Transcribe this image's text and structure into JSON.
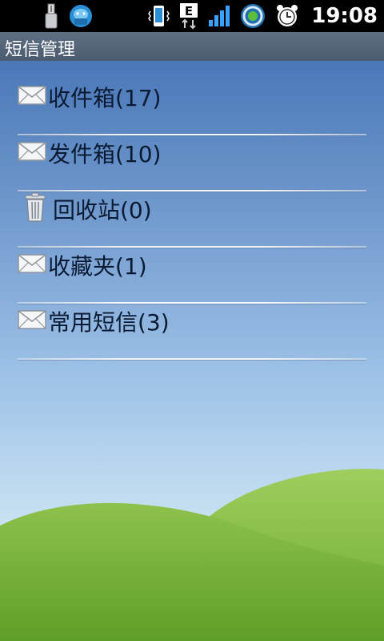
{
  "status_bar": {
    "time": "19:08",
    "left_icons": [
      "usb-icon",
      "android-debug-icon"
    ],
    "right_icons": [
      "vibrate-icon",
      "edge-data-icon",
      "signal-icon",
      "sync-icon",
      "alarm-icon"
    ],
    "network_type": "E"
  },
  "title_bar": {
    "title": "短信管理"
  },
  "menu": {
    "items": [
      {
        "icon": "envelope-icon",
        "label": "收件箱(17)"
      },
      {
        "icon": "envelope-icon",
        "label": "发件箱(10)"
      },
      {
        "icon": "trash-icon",
        "label": "回收站(0)"
      },
      {
        "icon": "envelope-icon",
        "label": "收藏夹(1)"
      },
      {
        "icon": "envelope-icon",
        "label": "常用短信(3)"
      }
    ]
  },
  "colors": {
    "title_bar": "#56667b",
    "sky_top": "#4a78b8",
    "sky_bottom": "#dceef6",
    "hill": "#7ab83e",
    "text": "#0b1a33"
  }
}
